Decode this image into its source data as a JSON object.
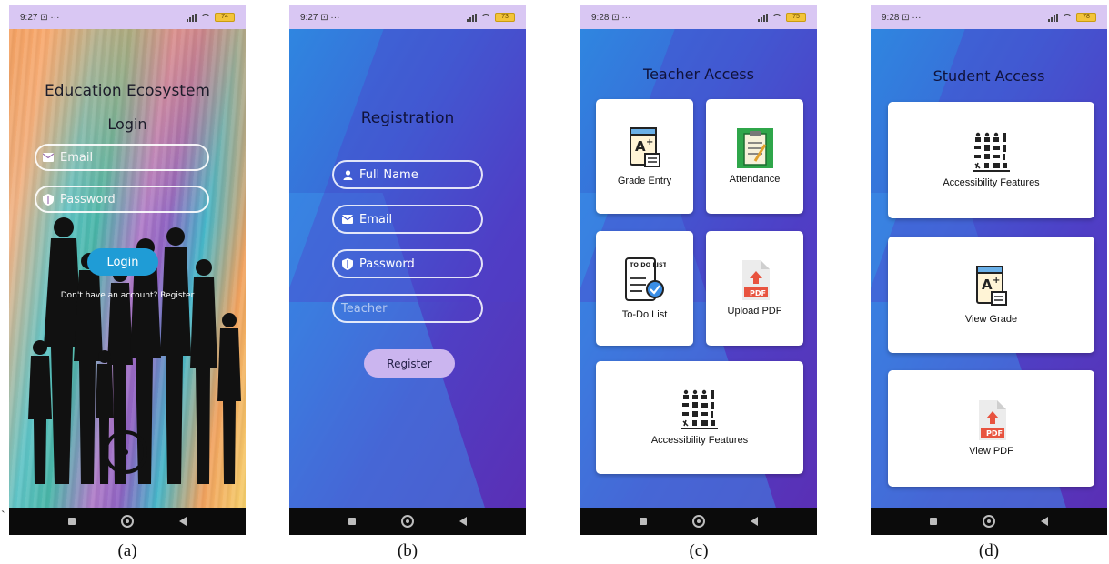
{
  "status_bar": {
    "time_a": "9:27",
    "time_b": "9:27",
    "time_c": "9:28",
    "time_d": "9:28",
    "more_glyph": "⊡ ···",
    "battery_a": "74",
    "battery_b": "73",
    "battery_c": "75",
    "battery_d": "78"
  },
  "login": {
    "title": "Education Ecosystem",
    "subtitle": "Login",
    "email_placeholder": "Email",
    "password_placeholder": "Password",
    "login_button": "Login",
    "register_prompt": "Don't have an account? Register"
  },
  "registration": {
    "title": "Registration",
    "full_name_placeholder": "Full Name",
    "email_placeholder": "Email",
    "password_placeholder": "Password",
    "role_value": "Teacher",
    "register_button": "Register"
  },
  "teacher": {
    "title": "Teacher Access",
    "grade_entry": "Grade Entry",
    "attendance": "Attendance",
    "todo_list": "To-Do List",
    "upload_pdf": "Upload PDF",
    "accessibility": "Accessibility Features",
    "todo_icon_text": "TO DO LIST:",
    "pdf_badge": "PDF"
  },
  "student": {
    "title": "Student Access",
    "accessibility": "Accessibility Features",
    "view_grade": "View Grade",
    "view_pdf": "View PDF",
    "pdf_badge": "PDF"
  },
  "captions": [
    "(a)",
    "(b)",
    "(c)",
    "(d)"
  ],
  "stray_mark": "`",
  "colors": {
    "status_bar": "#d9c7f3",
    "login_button": "#1f9cd6",
    "register_button": "#cbb5ef",
    "gradient_start": "#2f86e0",
    "gradient_end": "#5a2fb5",
    "nav_bar": "#0b0b0b",
    "pdf_red": "#e8533f"
  },
  "icons": {
    "email": "envelope-icon",
    "password": "shield-icon",
    "full_name": "person-icon",
    "grade": "grade-a-plus-icon",
    "attendance": "clipboard-icon",
    "todo": "todo-list-icon",
    "pdf": "pdf-file-icon",
    "accessibility": "accessibility-grid-icon"
  }
}
